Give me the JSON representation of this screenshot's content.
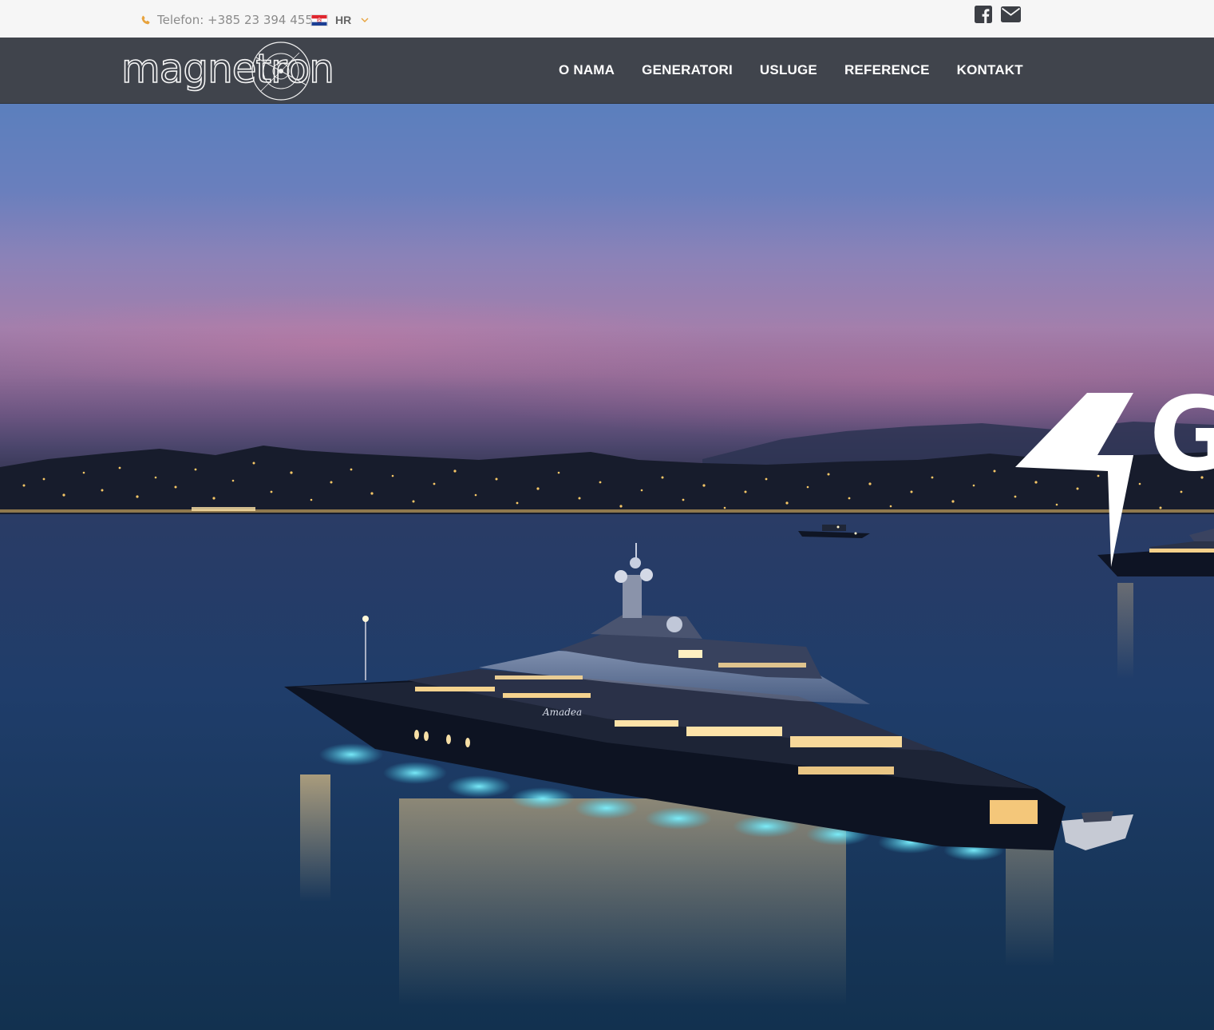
{
  "topbar": {
    "phone_label": "Telefon: +385 23 394 455",
    "language": "HR",
    "phone_icon": "phone-icon",
    "flag_icon": "croatia-flag-icon",
    "social_icons": [
      "facebook-icon",
      "email-icon"
    ]
  },
  "brand": {
    "logo_text": "magnetron"
  },
  "nav": {
    "items": [
      "O NAMA",
      "GENERATORI",
      "USLUGE",
      "REFERENCE",
      "KONTAKT"
    ]
  },
  "hero": {
    "overlay_letter": "G",
    "image_subject": "illuminated superyacht at dusk",
    "yacht_name": "Amadea"
  },
  "colors": {
    "topbar_bg": "#f6f6f6",
    "navbar_bg": "#40444c",
    "accent_phone": "#e8a33d",
    "nav_text": "#ffffff"
  }
}
